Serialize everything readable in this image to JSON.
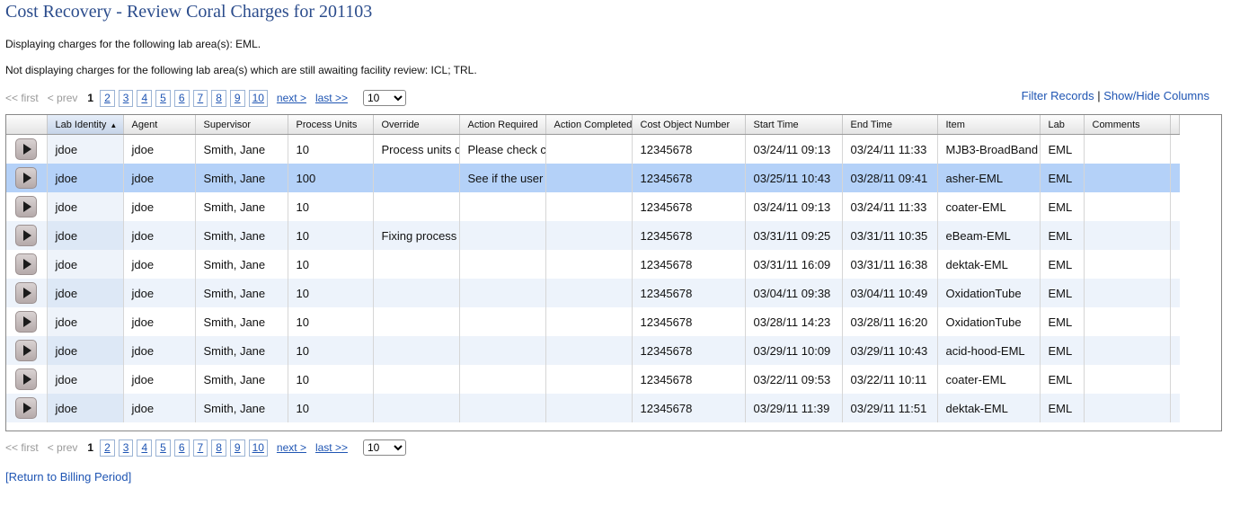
{
  "title": "Cost Recovery - Review Coral Charges for 201103",
  "info_line1": "Displaying charges for the following lab area(s): EML.",
  "info_line2": "Not displaying charges for the following lab area(s) which are still awaiting facility review: ICL; TRL.",
  "pager": {
    "first": "<< first",
    "prev": "< prev",
    "current": "1",
    "pages": [
      "2",
      "3",
      "4",
      "5",
      "6",
      "7",
      "8",
      "9",
      "10"
    ],
    "next": "next >",
    "last": "last >>",
    "per_page": "10"
  },
  "links": {
    "filter": "Filter Records",
    "separator": "|",
    "show_hide": "Show/Hide Columns"
  },
  "columns": [
    "Lab Identity",
    "Agent",
    "Supervisor",
    "Process Units",
    "Override",
    "Action Required",
    "Action Completed",
    "Cost Object Number",
    "Start Time",
    "End Time",
    "Item",
    "Lab",
    "Comments"
  ],
  "rows": [
    [
      "jdoe",
      "jdoe",
      "Smith, Jane",
      "10",
      "Process units c",
      "Please check c",
      "",
      "12345678",
      "03/24/11 09:13",
      "03/24/11 11:33",
      "MJB3-BroadBand",
      "EML",
      ""
    ],
    [
      "jdoe",
      "jdoe",
      "Smith, Jane",
      "100",
      "",
      "See if the user",
      "",
      "12345678",
      "03/25/11 10:43",
      "03/28/11 09:41",
      "asher-EML",
      "EML",
      ""
    ],
    [
      "jdoe",
      "jdoe",
      "Smith, Jane",
      "10",
      "",
      "",
      "",
      "12345678",
      "03/24/11 09:13",
      "03/24/11 11:33",
      "coater-EML",
      "EML",
      ""
    ],
    [
      "jdoe",
      "jdoe",
      "Smith, Jane",
      "10",
      "Fixing process",
      "",
      "",
      "12345678",
      "03/31/11 09:25",
      "03/31/11 10:35",
      "eBeam-EML",
      "EML",
      ""
    ],
    [
      "jdoe",
      "jdoe",
      "Smith, Jane",
      "10",
      "",
      "",
      "",
      "12345678",
      "03/31/11 16:09",
      "03/31/11 16:38",
      "dektak-EML",
      "EML",
      ""
    ],
    [
      "jdoe",
      "jdoe",
      "Smith, Jane",
      "10",
      "",
      "",
      "",
      "12345678",
      "03/04/11 09:38",
      "03/04/11 10:49",
      "OxidationTube",
      "EML",
      ""
    ],
    [
      "jdoe",
      "jdoe",
      "Smith, Jane",
      "10",
      "",
      "",
      "",
      "12345678",
      "03/28/11 14:23",
      "03/28/11 16:20",
      "OxidationTube",
      "EML",
      ""
    ],
    [
      "jdoe",
      "jdoe",
      "Smith, Jane",
      "10",
      "",
      "",
      "",
      "12345678",
      "03/29/11 10:09",
      "03/29/11 10:43",
      "acid-hood-EML",
      "EML",
      ""
    ],
    [
      "jdoe",
      "jdoe",
      "Smith, Jane",
      "10",
      "",
      "",
      "",
      "12345678",
      "03/22/11 09:53",
      "03/22/11 10:11",
      "coater-EML",
      "EML",
      ""
    ],
    [
      "jdoe",
      "jdoe",
      "Smith, Jane",
      "10",
      "",
      "",
      "",
      "12345678",
      "03/29/11 11:39",
      "03/29/11 11:51",
      "dektak-EML",
      "EML",
      ""
    ]
  ],
  "selected_row": 1,
  "sort_column": "Lab Identity",
  "sort_direction": "ascending",
  "back_link": "[Return to Billing Period]",
  "colors": {
    "title": "#2b4c8c",
    "link": "#1f55b3",
    "selected_row": "#b4d1f8",
    "alt_row": "#edf3fb"
  },
  "icons": {
    "row_expand": "play-triangle-icon",
    "sort": "sort-ascending-icon"
  }
}
